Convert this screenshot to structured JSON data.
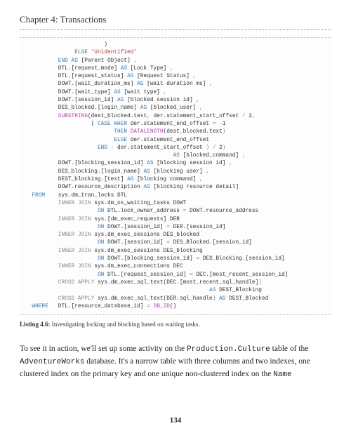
{
  "header": {
    "chapter": "Chapter 4: Transactions"
  },
  "code": {
    "line01a": "                        )",
    "line01b": "               ",
    "line01c": "ELSE",
    "line01d": " ",
    "line01e": "'Unidentified'",
    "line02a": "          ",
    "line02b": "END",
    "line02c": " ",
    "line02d": "AS",
    "line02e": " [Parent Object] ",
    "line02f": ",",
    "line03a": "          DTL.",
    "line03b": "[request_mode]",
    "line03c": " ",
    "line03d": "AS",
    "line03e": " [Lock Type] ",
    "line03f": ",",
    "line04a": "          DTL.",
    "line04b": "[request_status]",
    "line04c": " ",
    "line04d": "AS",
    "line04e": " [Request Status] ",
    "line04f": ",",
    "line05a": "          DOWT.",
    "line05b": "[wait_duration_ms]",
    "line05c": " ",
    "line05d": "AS",
    "line05e": " [wait duration ms] ",
    "line05f": ",",
    "line06a": "          DOWT.",
    "line06b": "[wait_type]",
    "line06c": " ",
    "line06d": "AS",
    "line06e": " [wait type] ",
    "line06f": ",",
    "line07a": "          DOWT.",
    "line07b": "[session_id]",
    "line07c": " ",
    "line07d": "AS",
    "line07e": " [blocked session id] ",
    "line07f": ",",
    "line08a": "          DES_blocked.",
    "line08b": "[login_name]",
    "line08c": " ",
    "line08d": "AS",
    "line08e": " [blocked_user] ",
    "line08f": ",",
    "line09a": "          ",
    "line09b": "SUBSTRING",
    "line09c": "(dest_blocked.text",
    "line09d": ",",
    "line09e": " der.statement_start_offset ",
    "line09f": "/",
    "line09g": " 2",
    "line09h": ",",
    "line10a": "                    ( ",
    "line10b": "CASE",
    "line10c": " ",
    "line10d": "WHEN",
    "line10e": " der.statement_end_offset ",
    "line10f": "=",
    "line10g": " ",
    "line10h": "-",
    "line10i": "1",
    "line11a": "                           ",
    "line11b": "THEN",
    "line11c": " ",
    "line11d": "DATALENGTH",
    "line11e": "(dest_blocked.text",
    "line11f": ")",
    "line12a": "                           ",
    "line12b": "ELSE",
    "line12c": " der.statement_end_offset",
    "line13a": "                      ",
    "line13b": "END",
    "line13c": " ",
    "line13d": "-",
    "line13e": " der.statement_start_offset ",
    "line13f": ")",
    "line13g": " ",
    "line13h": "/",
    "line13i": " 2",
    "line13j": ")",
    "line14a": "                                             ",
    "line14b": "AS",
    "line14c": " [blocked_command] ",
    "line14d": ",",
    "line15a": "          DOWT.",
    "line15b": "[blocking_session_id]",
    "line15c": " ",
    "line15d": "AS",
    "line15e": " [blocking session id] ",
    "line15f": ",",
    "line16a": "          DES_blocking.",
    "line16b": "[login_name]",
    "line16c": " ",
    "line16d": "AS",
    "line16e": " [blocking user] ",
    "line16f": ",",
    "line17a": "          DEST_blocking.",
    "line17b": "[text]",
    "line17c": " ",
    "line17d": "AS",
    "line17e": " [blocking command] ",
    "line17f": ",",
    "line18a": "          DOWT.resource_description ",
    "line18b": "AS",
    "line18c": " [blocking resource detail]",
    "line19a": "  ",
    "line19b": "FROM",
    "line19c": "    sys.dm_tran_locks DTL",
    "line20a": "          ",
    "line20b": "INNER",
    "line20c": " ",
    "line20d": "JOIN",
    "line20e": " sys.dm_os_waiting_tasks DOWT",
    "line21a": "                      ",
    "line21b": "ON",
    "line21c": " DTL.lock_owner_address ",
    "line21d": "=",
    "line21e": " DOWT.resource_address",
    "line22a": "          ",
    "line22b": "INNER",
    "line22c": " ",
    "line22d": "JOIN",
    "line22e": " sys.",
    "line22f": "[dm_exec_requests]",
    "line22g": " DER",
    "line23a": "                      ",
    "line23b": "ON",
    "line23c": " DOWT.",
    "line23d": "[session_id]",
    "line23e": " ",
    "line23f": "=",
    "line23g": " DER.",
    "line23h": "[session_id]",
    "line24a": "          ",
    "line24b": "INNER",
    "line24c": " ",
    "line24d": "JOIN",
    "line24e": " sys.dm_exec_sessions DES_blocked",
    "line25a": "                      ",
    "line25b": "ON",
    "line25c": " DOWT.",
    "line25d": "[session_id]",
    "line25e": " ",
    "line25f": "=",
    "line25g": " DES_Blocked.",
    "line25h": "[session_id]",
    "line26a": "          ",
    "line26b": "INNER",
    "line26c": " ",
    "line26d": "JOIN",
    "line26e": " sys.dm_exec_sessions DES_blocking",
    "line27a": "                      ",
    "line27b": "ON",
    "line27c": " DOWT.",
    "line27d": "[blocking_session_id]",
    "line27e": " ",
    "line27f": "=",
    "line27g": " DES_Blocking.",
    "line27h": "[session_id]",
    "line28a": "          ",
    "line28b": "INNER",
    "line28c": " ",
    "line28d": "JOIN",
    "line28e": " sys.dm_exec_connections DEC",
    "line29a": "                      ",
    "line29b": "ON",
    "line29c": " DTL.",
    "line29d": "[request_session_id]",
    "line29e": " ",
    "line29f": "=",
    "line29g": " DEC.",
    "line29h": "[most_recent_session_id]",
    "line30a": "          ",
    "line30b": "CROSS",
    "line30c": " ",
    "line30d": "APPLY",
    "line30e": " sys.dm_exec_sql_text(DEC.",
    "line30f": "[most_recent_sql_handle]",
    "line30g": ")",
    "line31a": "                                                        ",
    "line31b": "AS",
    "line31c": " DEST_Blocking",
    "line32a": "          ",
    "line32b": "CROSS",
    "line32c": " ",
    "line32d": "APPLY",
    "line32e": " sys.dm_exec_sql_text(DER.sql_handle",
    "line32f": ")",
    "line32g": " ",
    "line32h": "AS",
    "line32i": " DEST_Blocked",
    "line33a": "  ",
    "line33b": "WHERE",
    "line33c": "   DTL.",
    "line33d": "[resource_database_id]",
    "line33e": " ",
    "line33f": "=",
    "line33g": " ",
    "line33h": "DB_ID",
    "line33i": "()"
  },
  "caption": {
    "prefix": "Listing 4.6:",
    "text": "   Investigating locking and blocking based on waiting tasks."
  },
  "body": {
    "p1a": "To see it in action, we'll set up some activity on the ",
    "p1b": "Production.Culture",
    "p1c": " table of the ",
    "p1d": "AdventureWorks",
    "p1e": " database. It's a narrow table with three columns and two indexes, one clustered index on the primary key and one unique non-clustered index on the ",
    "p1f": "Name"
  },
  "page": "134"
}
